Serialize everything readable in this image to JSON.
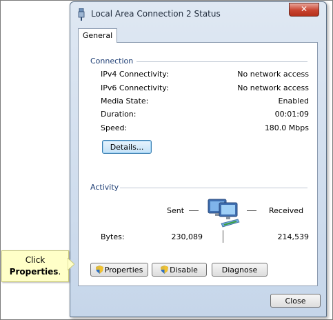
{
  "window": {
    "title": "Local Area Connection 2 Status",
    "close_glyph": "✕"
  },
  "tabs": [
    {
      "label": "General"
    }
  ],
  "connection": {
    "heading": "Connection",
    "rows": [
      {
        "label": "IPv4 Connectivity:",
        "value": "No network access"
      },
      {
        "label": "IPv6 Connectivity:",
        "value": "No network access"
      },
      {
        "label": "Media State:",
        "value": "Enabled"
      },
      {
        "label": "Duration:",
        "value": "00:01:09"
      },
      {
        "label": "Speed:",
        "value": "180.0 Mbps"
      }
    ],
    "details_button": "Details..."
  },
  "activity": {
    "heading": "Activity",
    "sent_label": "Sent",
    "received_label": "Received",
    "bytes_label": "Bytes:",
    "bytes_sent": "230,089",
    "bytes_received": "214,539",
    "icon": "network-computers-icon"
  },
  "buttons": {
    "properties": "Properties",
    "disable": "Disable",
    "diagnose": "Diagnose",
    "close": "Close"
  },
  "callout": {
    "line1": "Click",
    "line2": "Properties",
    "suffix": "."
  },
  "colors": {
    "heading": "#1c3c73",
    "callout_bg": "#ffffc8",
    "close_button": "#c8432f"
  }
}
